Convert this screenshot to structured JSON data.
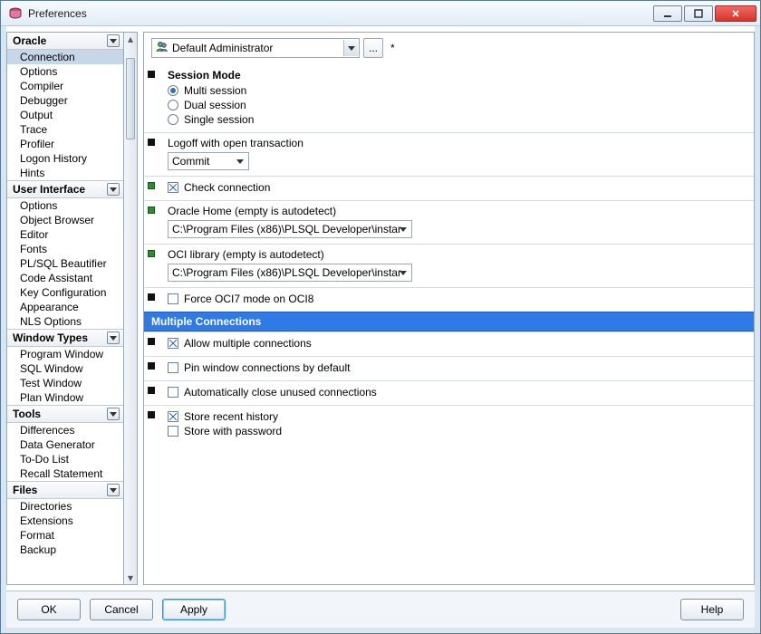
{
  "title": "Preferences",
  "profile_label": "Default Administrator",
  "modified_mark": "*",
  "sidebar": [
    {
      "head": "Oracle",
      "items": [
        "Connection",
        "Options",
        "Compiler",
        "Debugger",
        "Output",
        "Trace",
        "Profiler",
        "Logon History",
        "Hints"
      ],
      "selected": 0
    },
    {
      "head": "User Interface",
      "items": [
        "Options",
        "Object Browser",
        "Editor",
        "Fonts",
        "PL/SQL Beautifier",
        "Code Assistant",
        "Key Configuration",
        "Appearance",
        "NLS Options"
      ]
    },
    {
      "head": "Window Types",
      "items": [
        "Program Window",
        "SQL Window",
        "Test Window",
        "Plan Window"
      ]
    },
    {
      "head": "Tools",
      "items": [
        "Differences",
        "Data Generator",
        "To-Do List",
        "Recall Statement"
      ]
    },
    {
      "head": "Files",
      "items": [
        "Directories",
        "Extensions",
        "Format",
        "Backup"
      ]
    }
  ],
  "settings": {
    "session_title": "Session Mode",
    "session_modes": [
      "Multi session",
      "Dual session",
      "Single session"
    ],
    "logoff_label": "Logoff with open transaction",
    "logoff_value": "Commit",
    "check_conn": "Check connection",
    "oracle_home_label": "Oracle Home (empty is autodetect)",
    "oracle_home_value": "C:\\Program Files (x86)\\PLSQL Developer\\instar",
    "oci_label": "OCI library (empty is autodetect)",
    "oci_value": "C:\\Program Files (x86)\\PLSQL Developer\\instar",
    "force_oci7": "Force OCI7 mode on OCI8",
    "banner": "Multiple Connections",
    "allow_multi": "Allow multiple connections",
    "pin_default": "Pin window connections by default",
    "auto_close": "Automatically close unused connections",
    "store_recent": "Store recent history",
    "store_pw": "Store with password"
  },
  "buttons": {
    "ok": "OK",
    "cancel": "Cancel",
    "apply": "Apply",
    "help": "Help"
  },
  "ellipsis": "..."
}
